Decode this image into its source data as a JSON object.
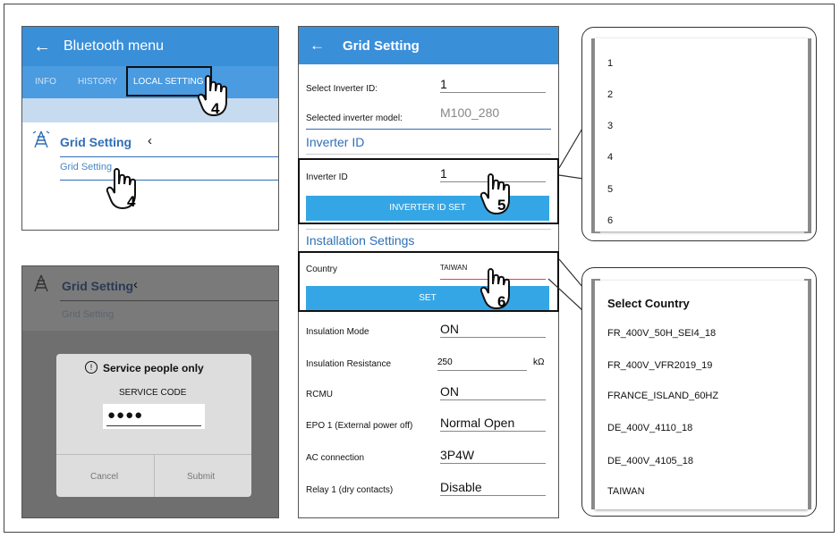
{
  "panel1": {
    "title": "Bluetooth menu",
    "tabs": [
      {
        "label": "INFO"
      },
      {
        "label": "HISTORY"
      },
      {
        "label": "LOCAL SETTING"
      }
    ],
    "section_title": "Grid Setting",
    "item": "Grid Setting",
    "step_top": "4",
    "step_bottom": "4"
  },
  "panel2": {
    "section_title": "Grid Setting",
    "item": "Grid Setting",
    "dialog": {
      "title": "Service people only",
      "label": "SERVICE CODE",
      "value": "●●●●",
      "cancel": "Cancel",
      "submit": "Submit"
    }
  },
  "panel3": {
    "title": "Grid Setting",
    "select_id_label": "Select Inverter ID:",
    "select_id_value": "1",
    "model_label": "Selected inverter model:",
    "model_value": "M100_280",
    "inverter_id_section": "Inverter ID",
    "inverter_id_label": "Inverter ID",
    "inverter_id_value": "1",
    "inverter_id_button": "INVERTER ID SET",
    "installation_section": "Installation Settings",
    "country_label": "Country",
    "country_value": "TAIWAN",
    "set_button": "SET",
    "step5": "5",
    "step6": "6",
    "rows": [
      {
        "label": "Insulation Mode",
        "value": "ON",
        "unit": ""
      },
      {
        "label": "Insulation Resistance",
        "value": "250",
        "unit": "kΩ"
      },
      {
        "label": "RCMU",
        "value": "ON",
        "unit": ""
      },
      {
        "label": "EPO 1 (External power off)",
        "value": "Normal Open",
        "unit": ""
      },
      {
        "label": "AC connection",
        "value": "3P4W",
        "unit": ""
      },
      {
        "label": "Relay 1 (dry contacts)",
        "value": "Disable",
        "unit": ""
      }
    ]
  },
  "callout_ids": {
    "items": [
      "1",
      "2",
      "3",
      "4",
      "5",
      "6"
    ]
  },
  "callout_country": {
    "title": "Select Country",
    "items": [
      "FR_400V_50H_SEI4_18",
      "FR_400V_VFR2019_19",
      "FRANCE_ISLAND_60HZ",
      "DE_400V_4110_18",
      "DE_400V_4105_18",
      "TAIWAN"
    ]
  },
  "colors": {
    "accent": "#2f86d6",
    "button": "#35a6e5",
    "section": "#2f6fb6"
  }
}
